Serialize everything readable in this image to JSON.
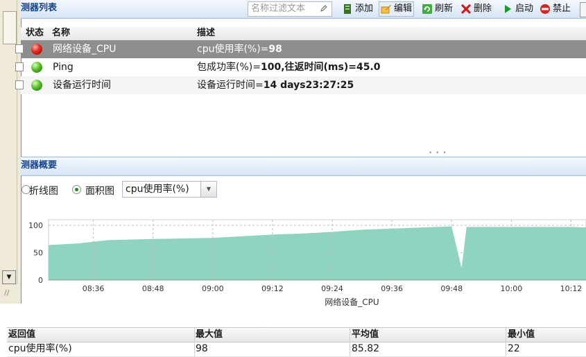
{
  "monitor_list": {
    "title": "测器列表",
    "filter_placeholder": "名称过滤文本",
    "toolbar": {
      "add": "添加",
      "edit": "编辑",
      "refresh": "刷新",
      "delete": "删除",
      "start": "启动",
      "disable": "禁止"
    },
    "columns": {
      "status": "状态",
      "name": "名称",
      "desc": "描述"
    },
    "rows": [
      {
        "name": "网络设备_CPU",
        "desc_prefix": "cpu使用率(%)=",
        "desc_value": "98",
        "status": "red"
      },
      {
        "name": "Ping",
        "desc_prefix": "包成功率(%)=",
        "desc_value": "100,往返时间(ms)=45.0",
        "status": "green"
      },
      {
        "name": "设备运行时间",
        "desc_prefix": "设备运行时间=",
        "desc_value": "14 days23:27:25",
        "status": "green"
      }
    ]
  },
  "summary": {
    "title": "测器概要",
    "view_line": "折线图",
    "view_area": "面积图",
    "metric_select": "cpu使用率(%)"
  },
  "chart_data": {
    "type": "area",
    "xlabel": "网络设备_CPU",
    "ylabel": "",
    "ylim": [
      0,
      100
    ],
    "yticks": [
      "0",
      "50",
      "100"
    ],
    "xticks": [
      "08:36",
      "08:48",
      "09:00",
      "09:12",
      "09:24",
      "09:36",
      "09:48",
      "10:00",
      "10:12"
    ],
    "x": [
      "08:27",
      "08:33",
      "08:36",
      "08:39",
      "08:48",
      "09:00",
      "09:06",
      "09:12",
      "09:18",
      "09:24",
      "09:30",
      "09:36",
      "09:42",
      "09:48",
      "09:50",
      "09:51",
      "09:54",
      "10:00",
      "10:12",
      "10:15"
    ],
    "values": [
      64,
      67,
      70,
      73,
      75,
      77,
      80,
      83,
      85,
      88,
      92,
      94,
      96,
      98,
      22,
      97,
      97,
      97,
      97,
      96
    ],
    "grid": true,
    "fill_color": "#8fd3c1"
  },
  "stats": {
    "columns": {
      "return": "返回值",
      "max": "最大值",
      "avg": "平均值",
      "min": "最小值"
    },
    "row": {
      "return": "cpu使用率(%)",
      "max": "98",
      "avg": "85.82",
      "min": "22"
    }
  }
}
